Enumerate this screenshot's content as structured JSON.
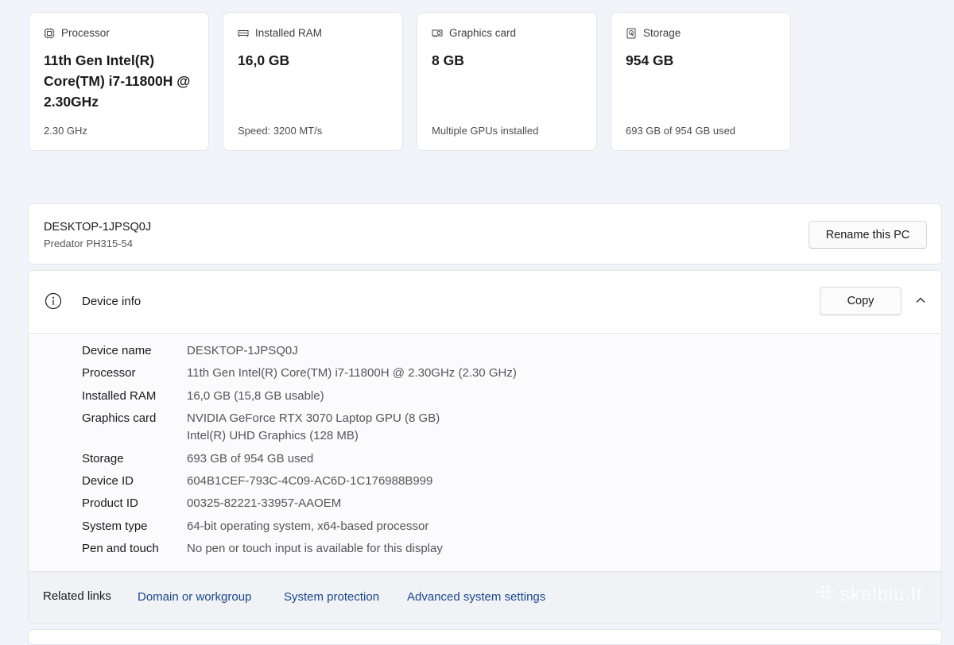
{
  "cards": [
    {
      "title": "Processor",
      "icon": "processor-icon",
      "value": "11th Gen Intel(R) Core(TM) i7-11800H @ 2.30GHz",
      "sub": "2.30 GHz"
    },
    {
      "title": "Installed RAM",
      "icon": "ram-icon",
      "value": "16,0 GB",
      "sub": "Speed: 3200 MT/s"
    },
    {
      "title": "Graphics card",
      "icon": "graphics-card-icon",
      "value": "8 GB",
      "sub": "Multiple GPUs installed"
    },
    {
      "title": "Storage",
      "icon": "storage-icon",
      "value": "954 GB",
      "sub": "693 GB of 954 GB used"
    }
  ],
  "pc": {
    "name": "DESKTOP-1JPSQ0J",
    "model": "Predator PH315-54",
    "rename_label": "Rename this PC"
  },
  "device_info": {
    "title": "Device info",
    "copy_label": "Copy",
    "specs": [
      {
        "label": "Device name",
        "value": "DESKTOP-1JPSQ0J"
      },
      {
        "label": "Processor",
        "value": "11th Gen Intel(R) Core(TM) i7-11800H @ 2.30GHz (2.30 GHz)"
      },
      {
        "label": "Installed RAM",
        "value": "16,0 GB (15,8 GB usable)"
      },
      {
        "label": "Graphics card",
        "value": "NVIDIA GeForce RTX 3070 Laptop GPU (8 GB)",
        "value2": "Intel(R) UHD Graphics (128 MB)"
      },
      {
        "label": "Storage",
        "value": "693 GB of 954 GB used"
      },
      {
        "label": "Device ID",
        "value": "604B1CEF-793C-4C09-AC6D-1C176988B999"
      },
      {
        "label": "Product ID",
        "value": "00325-82221-33957-AAOEM"
      },
      {
        "label": "System type",
        "value": "64-bit operating system, x64-based processor"
      },
      {
        "label": "Pen and touch",
        "value": "No pen or touch input is available for this display"
      }
    ]
  },
  "related": {
    "title": "Related links",
    "links": [
      "Domain or workgroup",
      "System protection",
      "Advanced system settings"
    ]
  },
  "watermark": "skelbiu.lt",
  "colors": {
    "background": "#f3f4f9",
    "link": "#17488d",
    "card": "#ffffff"
  }
}
